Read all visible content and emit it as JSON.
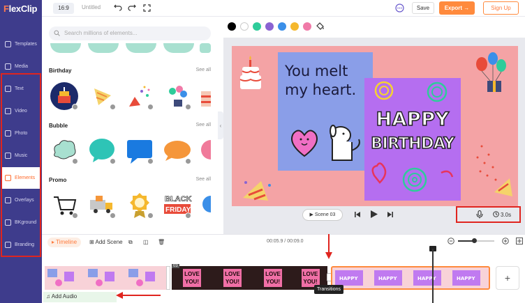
{
  "app": {
    "logo_text": "lexClip",
    "logo_letter": "F"
  },
  "sidebar": {
    "items": [
      {
        "label": "Templates",
        "icon": "template-icon"
      },
      {
        "label": "Media",
        "icon": "media-icon"
      },
      {
        "label": "Text",
        "icon": "text-icon"
      },
      {
        "label": "Video",
        "icon": "video-icon"
      },
      {
        "label": "Photo",
        "icon": "photo-icon"
      },
      {
        "label": "Music",
        "icon": "music-icon"
      },
      {
        "label": "Elements",
        "icon": "elements-icon"
      },
      {
        "label": "Overlays",
        "icon": "overlays-icon"
      },
      {
        "label": "BKground",
        "icon": "background-icon"
      },
      {
        "label": "Branding",
        "icon": "branding-icon"
      }
    ],
    "active_index": 6
  },
  "topbar": {
    "ratio": "16:9",
    "title": "Untitled",
    "save": "Save",
    "export": "Export →",
    "signup": "Sign Up"
  },
  "panel": {
    "search_placeholder": "Search millions of elements...",
    "sections": [
      {
        "title": "Birthday",
        "see_all": "See all"
      },
      {
        "title": "Bubble",
        "see_all": "See all"
      },
      {
        "title": "Promo",
        "see_all": "See all"
      }
    ],
    "promo_black_friday": "BLACK FRIDAY"
  },
  "palette": {
    "colors": [
      "#000000",
      "#ffffff",
      "#2ecc9a",
      "#8a63d2",
      "#3b8fe8",
      "#f5b82e",
      "#f07aa8"
    ]
  },
  "canvas": {
    "note_text_line1": "You melt",
    "note_text_line2": "my heart.",
    "happy": "HAPPY",
    "birthday": "BIRTHDAY",
    "background_color": "#f4a3a5"
  },
  "playbar": {
    "scene": "Scene 03",
    "duration": "3.0s"
  },
  "timeline": {
    "label": "Timeline",
    "add_scene": "Add Scene",
    "time": "00:05.9 / 00:09.0",
    "love_text": "LOVE YOU!",
    "transitions": "Transitions",
    "add_audio": "Add Audio",
    "add_plus": "+",
    "clip_badge": "03"
  }
}
